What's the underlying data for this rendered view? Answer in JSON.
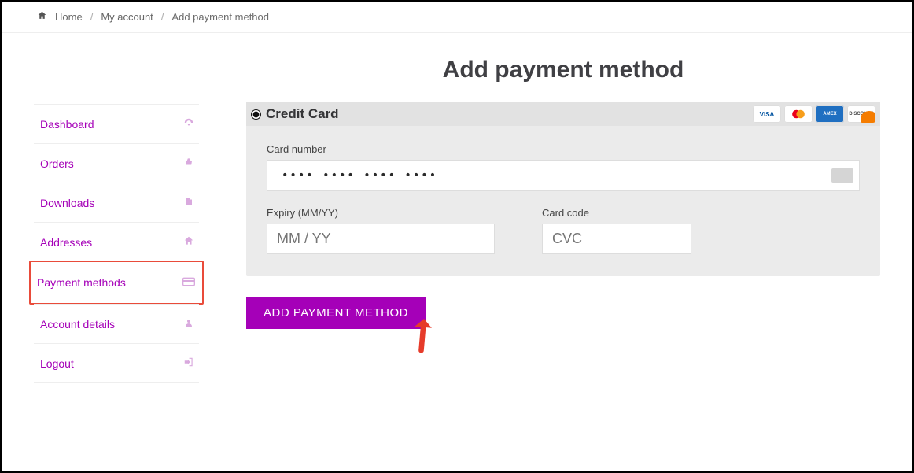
{
  "breadcrumb": {
    "home": "Home",
    "account": "My account",
    "current": "Add payment method"
  },
  "page": {
    "title": "Add payment method"
  },
  "sidebar": {
    "items": [
      {
        "label": "Dashboard",
        "icon": "dashboard-icon"
      },
      {
        "label": "Orders",
        "icon": "basket-icon"
      },
      {
        "label": "Downloads",
        "icon": "file-icon"
      },
      {
        "label": "Addresses",
        "icon": "house-icon"
      },
      {
        "label": "Payment methods",
        "icon": "card-icon",
        "selected": true
      },
      {
        "label": "Account details",
        "icon": "user-icon"
      },
      {
        "label": "Logout",
        "icon": "signout-icon"
      }
    ]
  },
  "payment_method": {
    "radio_label": "Credit Card",
    "brands": [
      "VISA",
      "mastercard",
      "AMERICAN EXPRESS",
      "DISCOVER"
    ],
    "card_number_label": "Card number",
    "card_number_value": "•••• •••• •••• ••••",
    "expiry_label": "Expiry (MM/YY)",
    "expiry_placeholder": "MM / YY",
    "cvc_label": "Card code",
    "cvc_placeholder": "CVC"
  },
  "actions": {
    "submit": "ADD PAYMENT METHOD"
  },
  "annotation": {
    "highlight": "payment-methods",
    "pointer": "red-arrow"
  }
}
